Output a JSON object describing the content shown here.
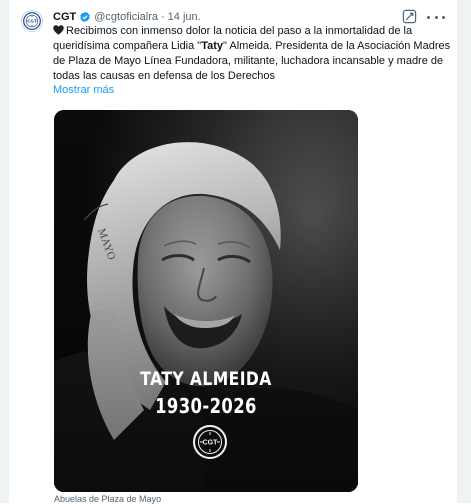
{
  "account": {
    "name": "CGT",
    "handle": "@cgtoficialra",
    "separator": "·",
    "date": "14 jun.",
    "avatar_logo_text": "CGT"
  },
  "post": {
    "text_part1": "Recibimos con inmenso dolor la noticia del paso a la inmortalidad de la queridísima compañera Lidia \"",
    "text_bold": "Taty",
    "text_part2": "\" Almeida. Presidenta de la Asociación Madres de Plaza de Mayo Línea Fundadora, militante, luchadora incansable y madre de todas las causas en defensa de los Derechos",
    "show_more": "Mostrar más"
  },
  "media": {
    "overlay_name": "TATY ALMEIDA",
    "overlay_years": "1930-2026",
    "logo_text": "CGT",
    "caption": "Abuelas de Plaza de Mayo"
  },
  "icons": {
    "heart": "black-heart-icon",
    "verified": "verified-badge-icon",
    "grok": "grok-icon",
    "more": "more-options-icon"
  },
  "colors": {
    "accent": "#1d9bf0",
    "secondary_text": "#536471",
    "primary_text": "#0f1419",
    "logo_blue": "#1a4a8c"
  }
}
